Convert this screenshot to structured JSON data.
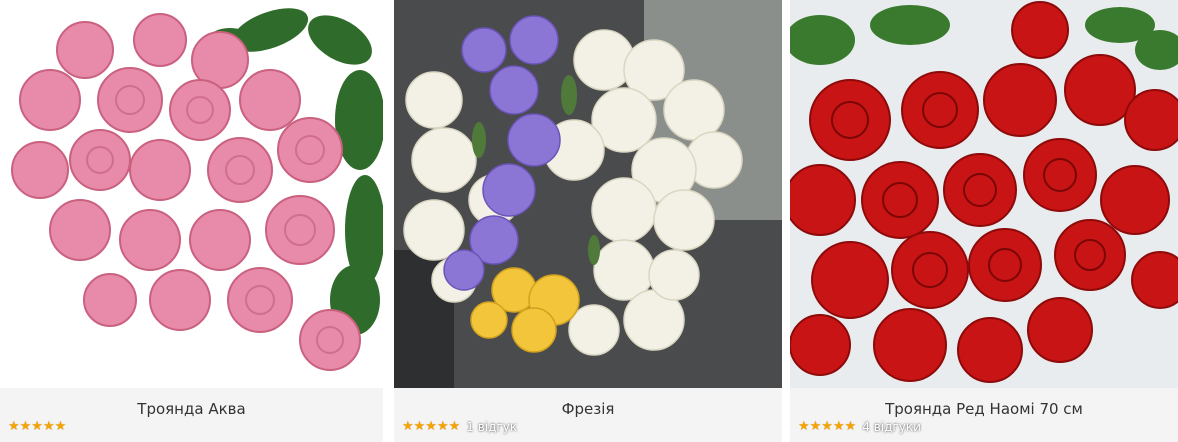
{
  "products": [
    {
      "name": "Троянда Аква",
      "stars": "★★★★★",
      "rating": 5,
      "reviews": ""
    },
    {
      "name": "Фрезія",
      "stars": "★★★★★",
      "rating": 5,
      "reviews": "1 відгук"
    },
    {
      "name": "Троянда Ред Наомі 70 см",
      "stars": "★★★★★",
      "rating": 5,
      "reviews": "4 відгуки"
    }
  ],
  "colors": {
    "star": "#f5a300",
    "card_bg": "#f4f4f4",
    "title_text": "#333333"
  }
}
